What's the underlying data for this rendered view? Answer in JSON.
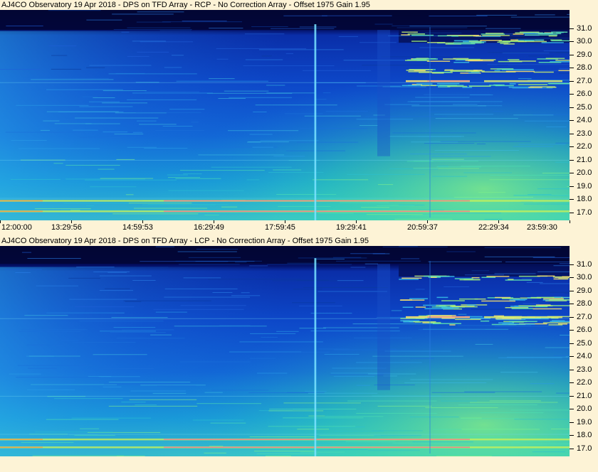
{
  "chart_data": [
    {
      "type": "heatmap",
      "title": "AJ4CO Observatory 19 Apr 2018 - DPS on TFD Array  - RCP  -  No Correction Array  -  Offset 1975  Gain 1.95",
      "y_tick_labels": [
        "31.0",
        "30.0",
        "29.0",
        "28.0",
        "27.0",
        "26.0",
        "25.0",
        "24.0",
        "23.0",
        "22.0",
        "21.0",
        "20.0",
        "19.0",
        "18.0",
        "17.0"
      ],
      "y_ticks": [
        31,
        30,
        29,
        28,
        27,
        26,
        25,
        24,
        23,
        22,
        21,
        20,
        19,
        18,
        17
      ],
      "ylim": [
        16.4,
        32.4
      ],
      "x_tick_labels": [
        "12:00:00",
        "13:29:56",
        "14:59:53",
        "16:29:49",
        "17:59:45",
        "19:29:41",
        "20:59:37",
        "22:29:34",
        "23:59:30"
      ],
      "features": {
        "strong_bands": [
          17.9,
          17.1,
          27.0
        ],
        "burst_column": 0.553,
        "dark_edge": 0.095,
        "noise_region_bands": [
          26.7,
          27.8,
          28.6,
          30.0,
          30.6
        ]
      }
    },
    {
      "type": "heatmap",
      "title": "AJ4CO Observatory 19 Apr 2018 - DPS on TFD Array  - LCP  -  No Correction Array  -  Offset 1975  Gain 1.95",
      "y_tick_labels": [
        "31.0",
        "30.0",
        "29.0",
        "28.0",
        "27.0",
        "26.0",
        "25.0",
        "24.0",
        "23.0",
        "22.0",
        "21.0",
        "20.0",
        "19.0",
        "18.0",
        "17.0"
      ],
      "y_ticks": [
        31,
        30,
        29,
        28,
        27,
        26,
        25,
        24,
        23,
        22,
        21,
        20,
        19,
        18,
        17
      ],
      "ylim": [
        16.4,
        32.4
      ],
      "x_tick_labels": [],
      "features": {
        "strong_bands": [
          17.7,
          17.1,
          27.0
        ],
        "burst_column": 0.553,
        "dark_edge": 0.085,
        "noise_region_bands": [
          26.6,
          27.0,
          27.8,
          28.4,
          30.0
        ]
      }
    }
  ]
}
